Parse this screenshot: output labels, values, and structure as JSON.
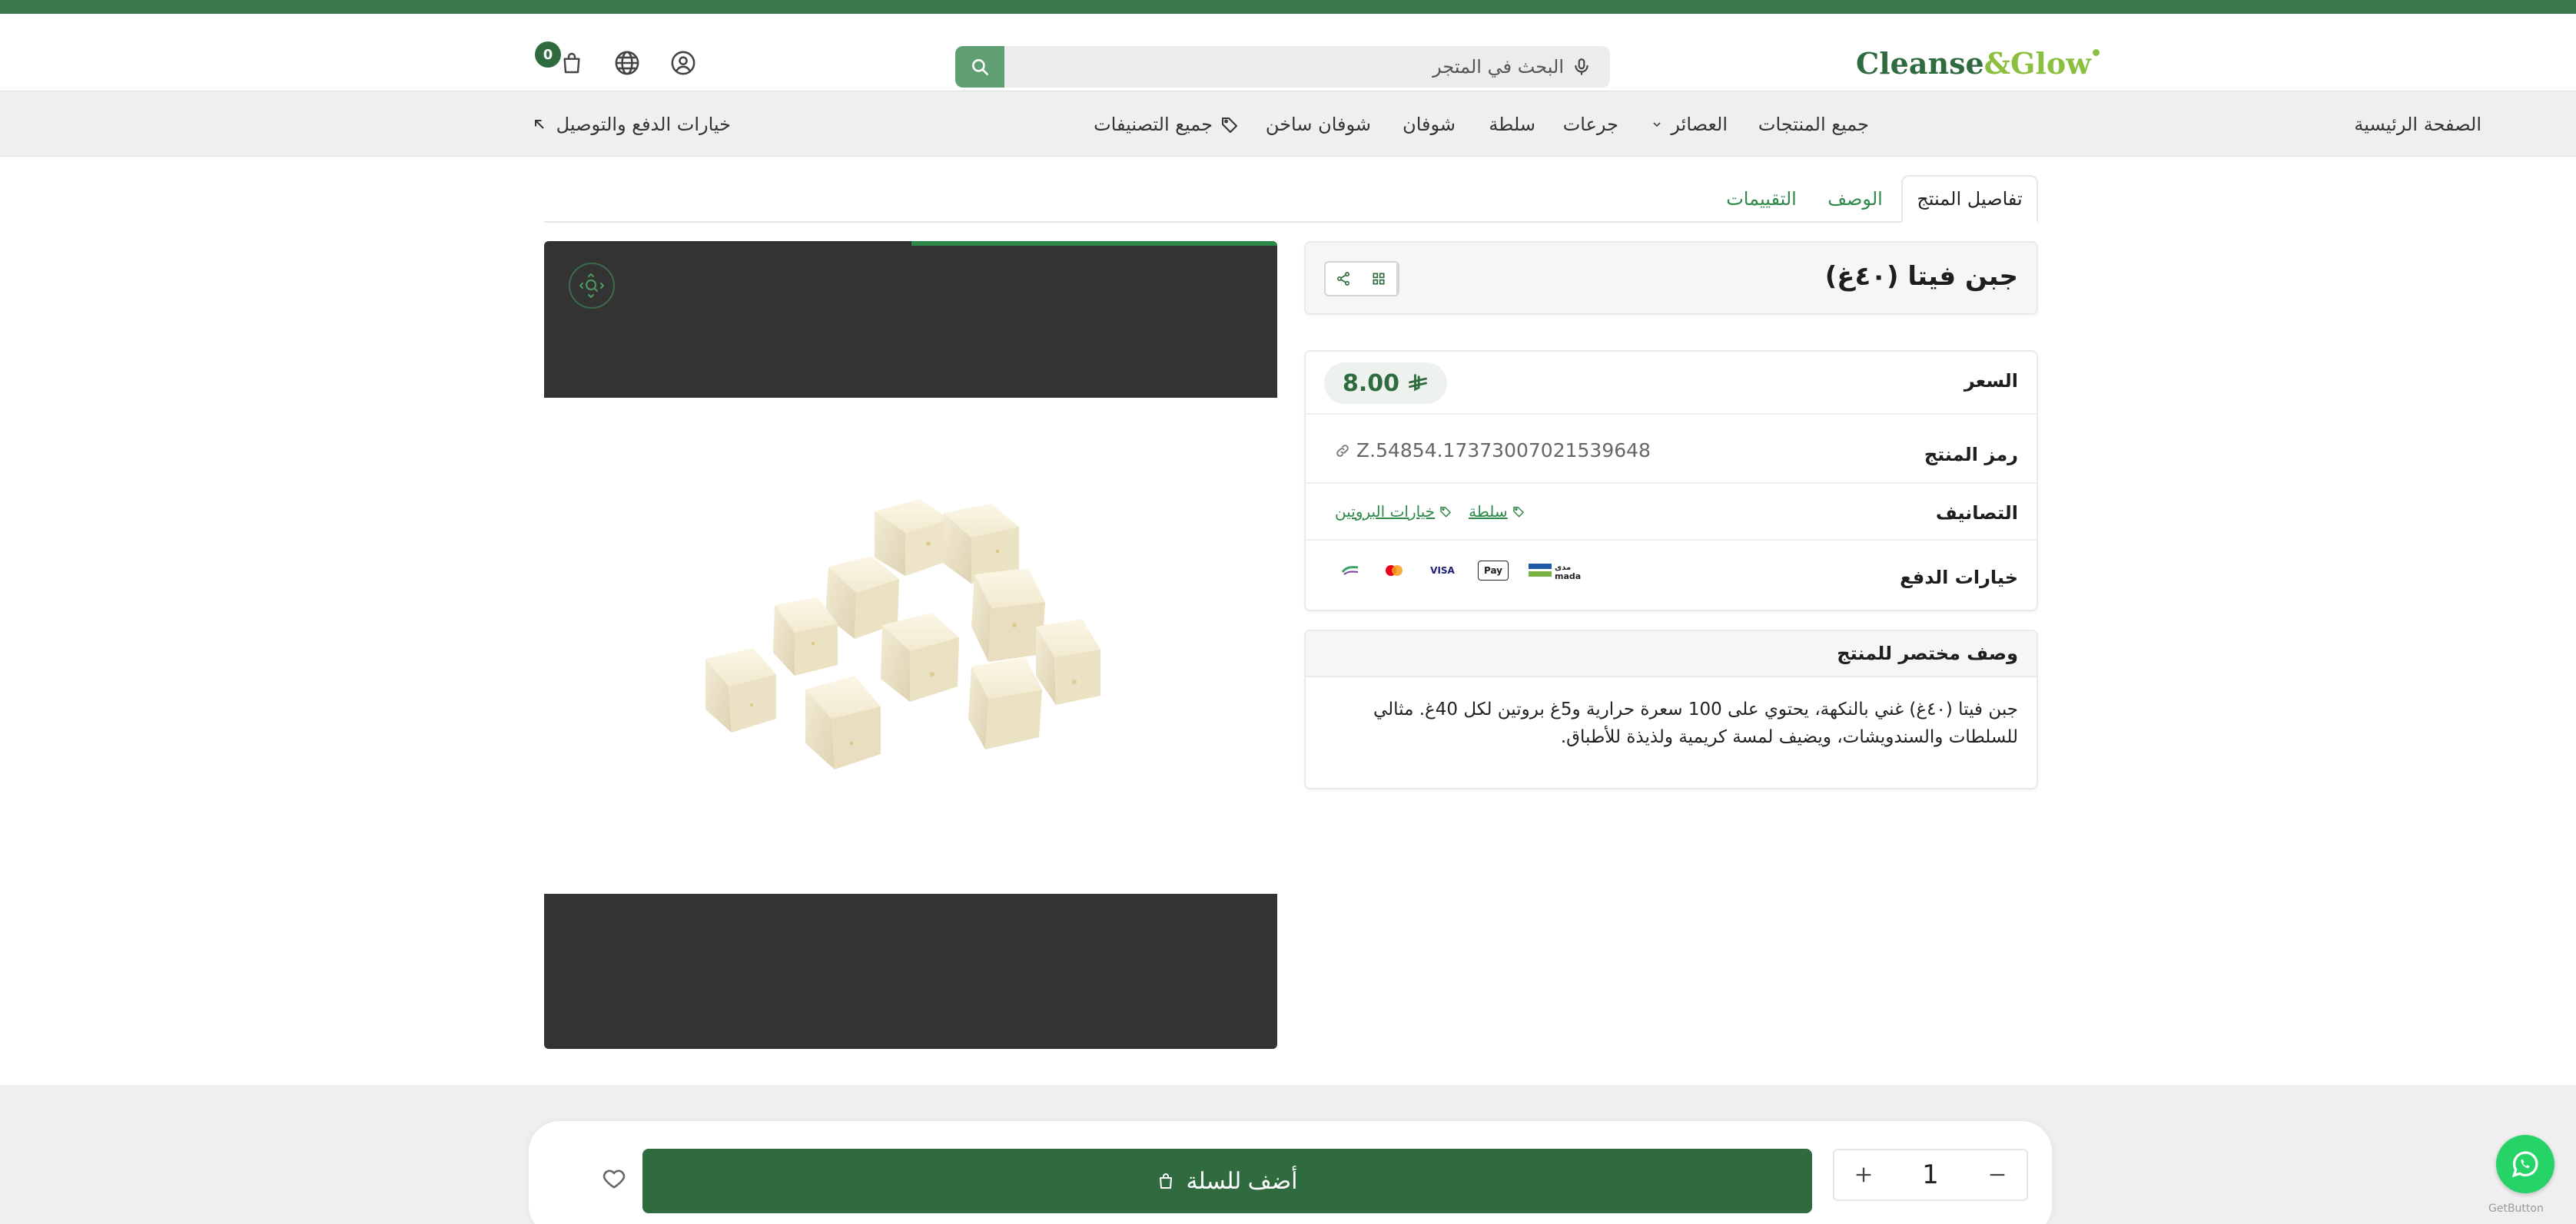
{
  "header": {
    "logo_text_a": "Cleanse",
    "logo_amp": "&",
    "logo_text_b": "Glow",
    "search_placeholder": "البحث في المتجر",
    "cart_count": "0"
  },
  "nav": {
    "items": [
      {
        "label": "الصفحة الرئيسية"
      },
      {
        "label": "جميع المنتجات"
      },
      {
        "label": "العصائر"
      },
      {
        "label": "جرعات"
      },
      {
        "label": "سلطة"
      },
      {
        "label": "شوفان"
      },
      {
        "label": "شوفان ساخن"
      },
      {
        "label": "جميع التصنيفات"
      }
    ],
    "payment_link": "خيارات الدفع والتوصيل"
  },
  "tabs": [
    {
      "label": "تفاصيل المنتج",
      "active": true
    },
    {
      "label": "الوصف",
      "active": false
    },
    {
      "label": "التقييمات",
      "active": false
    }
  ],
  "product": {
    "title": "جبن فيتا (٤٠غ)",
    "price_label": "السعر",
    "price": "8.00",
    "sku_label": "رمز المنتج",
    "sku": "Z.54854.17373007021539648",
    "categories_label": "التصانيف",
    "categories": [
      "سلطة",
      "خيارات البروتين"
    ],
    "payment_label": "خيارات الدفع",
    "payment_methods": [
      "mada",
      "Apple Pay",
      "VISA",
      "Mastercard",
      "STC Pay"
    ],
    "short_desc_label": "وصف مختصر للمنتج",
    "short_desc": "جبن فيتا (٤٠غ) غني بالنكهة، يحتوي على 100 سعرة حرارية و5غ بروتين لكل 40غ. مثالي للسلطات والسندويشات، ويضيف لمسة كريمية ولذيذة للأطباق."
  },
  "viewer": {
    "progress": 0.5
  },
  "cart_bar": {
    "add_label": "أضف للسلة",
    "quantity": "1"
  },
  "widget": {
    "getbutton": "GetButton"
  },
  "colors": {
    "brand_green": "#2f6b3e",
    "accent_green": "#2f8a4a",
    "logo_lime": "#8bbf3f",
    "whatsapp": "#25d366"
  }
}
